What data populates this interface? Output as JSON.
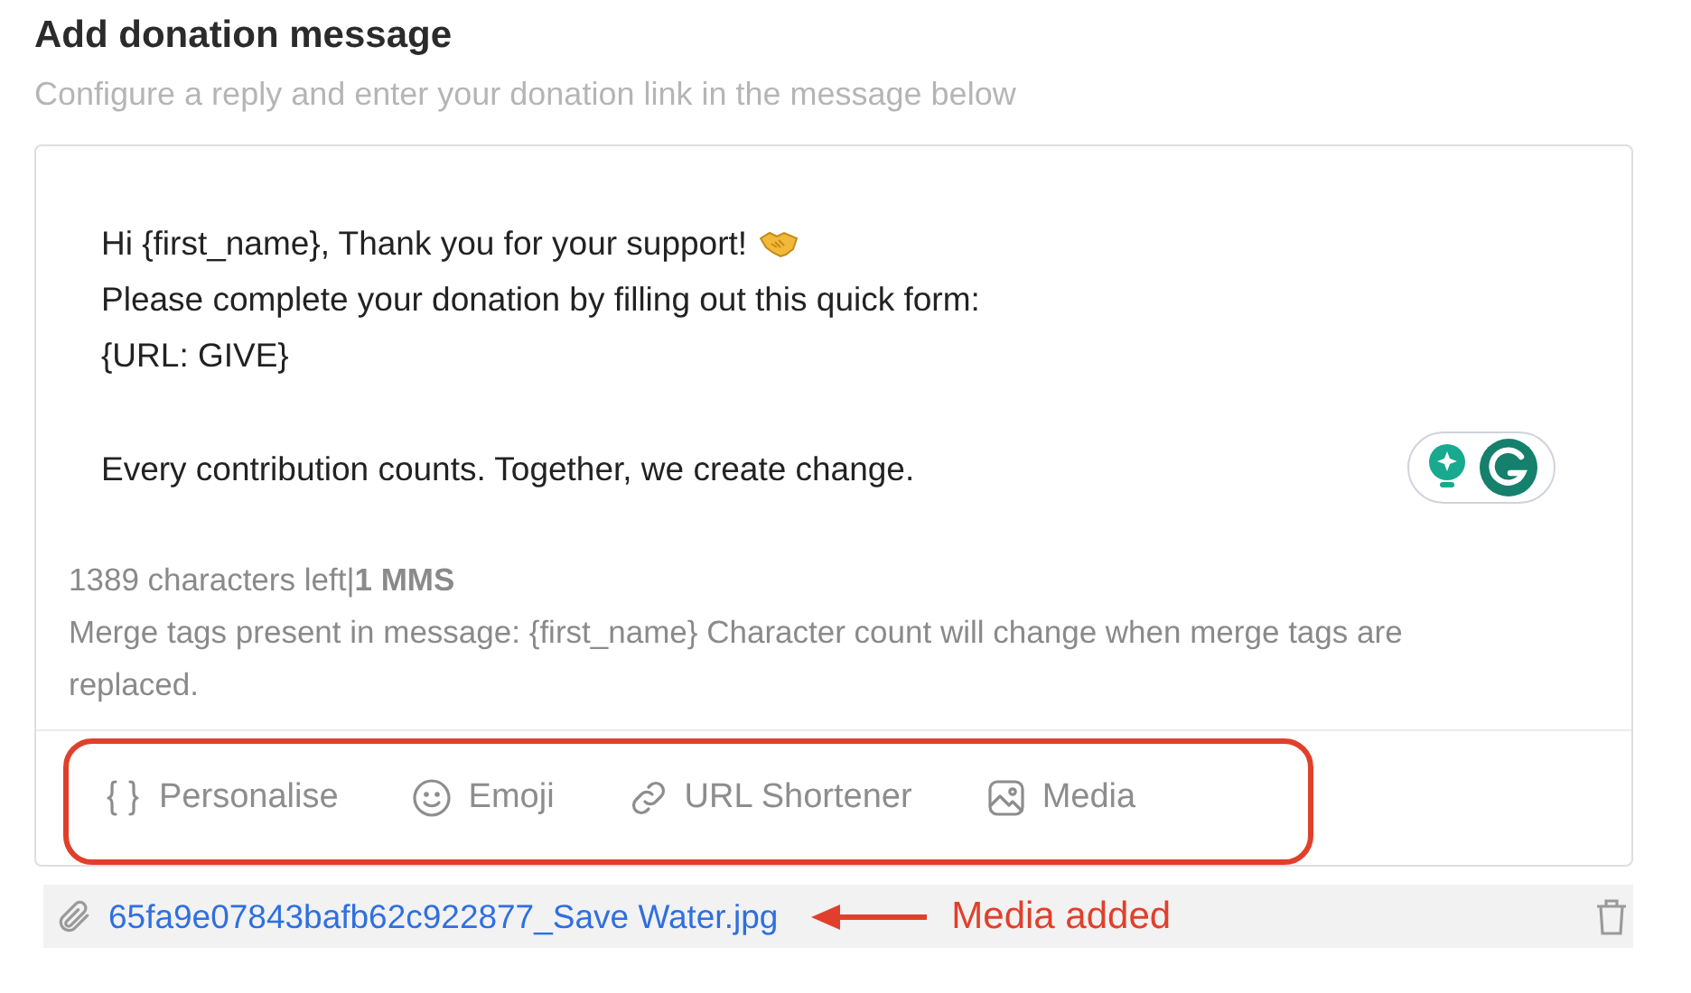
{
  "title": "Add donation message",
  "subtitle": "Configure a reply and enter your donation link in the message below",
  "message": {
    "paragraphs": [
      [
        {
          "text": "Hi {first_name}, Thank you for your support!",
          "emoji": true
        },
        {
          "text": "Please complete your donation by filling out this quick form:",
          "emoji": false
        },
        {
          "text": "{URL: GIVE}",
          "emoji": false
        }
      ],
      [
        {
          "text": "Every contribution counts. Together, we create change.",
          "emoji": false
        }
      ]
    ]
  },
  "counter": {
    "characters_left": "1389 characters left",
    "separator": "|",
    "segments": "1 MMS"
  },
  "merge_note": "Merge tags present in message: {first_name} Character count will change when merge tags are replaced.",
  "toolbar": [
    {
      "kind": "braces",
      "label": "Personalise"
    },
    {
      "kind": "emoji",
      "label": "Emoji"
    },
    {
      "kind": "link",
      "label": "URL Shortener"
    },
    {
      "kind": "image",
      "label": "Media"
    }
  ],
  "attachment": {
    "filename": "65fa9e07843bafb62c922877_Save Water.jpg"
  },
  "annotation": {
    "label": "Media added"
  }
}
